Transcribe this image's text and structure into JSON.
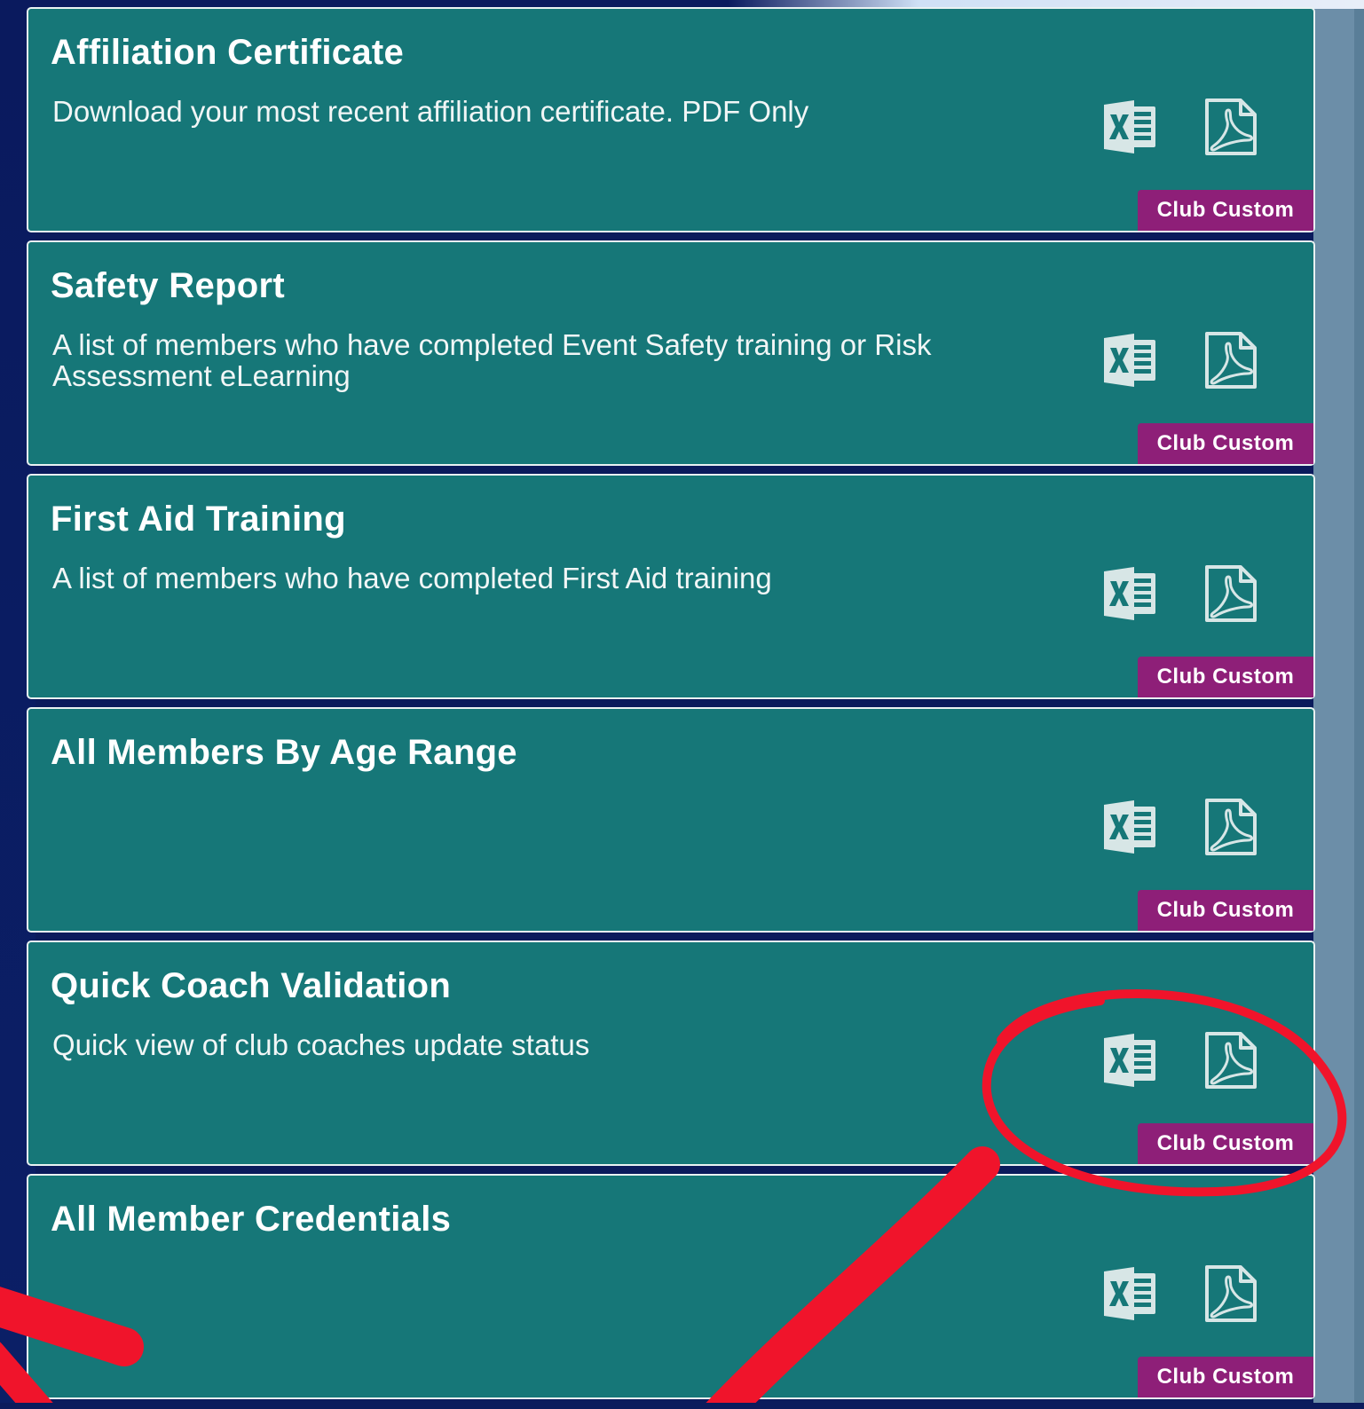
{
  "reports": [
    {
      "title": "Affiliation Certificate",
      "description": "Download your most recent affiliation certificate. PDF Only",
      "badge": "Club Custom"
    },
    {
      "title": "Safety Report",
      "description": "A list of members who have completed Event Safety training or Risk Assessment eLearning",
      "badge": "Club Custom"
    },
    {
      "title": "First Aid Training",
      "description": "A list of members who have completed First Aid training",
      "badge": "Club Custom"
    },
    {
      "title": "All Members By Age Range",
      "description": "",
      "badge": "Club Custom"
    },
    {
      "title": "Quick Coach Validation",
      "description": "Quick view of club coaches update status",
      "badge": "Club Custom"
    },
    {
      "title": "All Member Credentials",
      "description": "",
      "badge": "Club Custom"
    }
  ],
  "icons": {
    "excel": "excel-icon",
    "pdf": "pdf-icon"
  },
  "colors": {
    "card": "#167778",
    "badge": "#8e1f78",
    "annotation": "#f0142b",
    "page_background": "#0b1b5c"
  }
}
